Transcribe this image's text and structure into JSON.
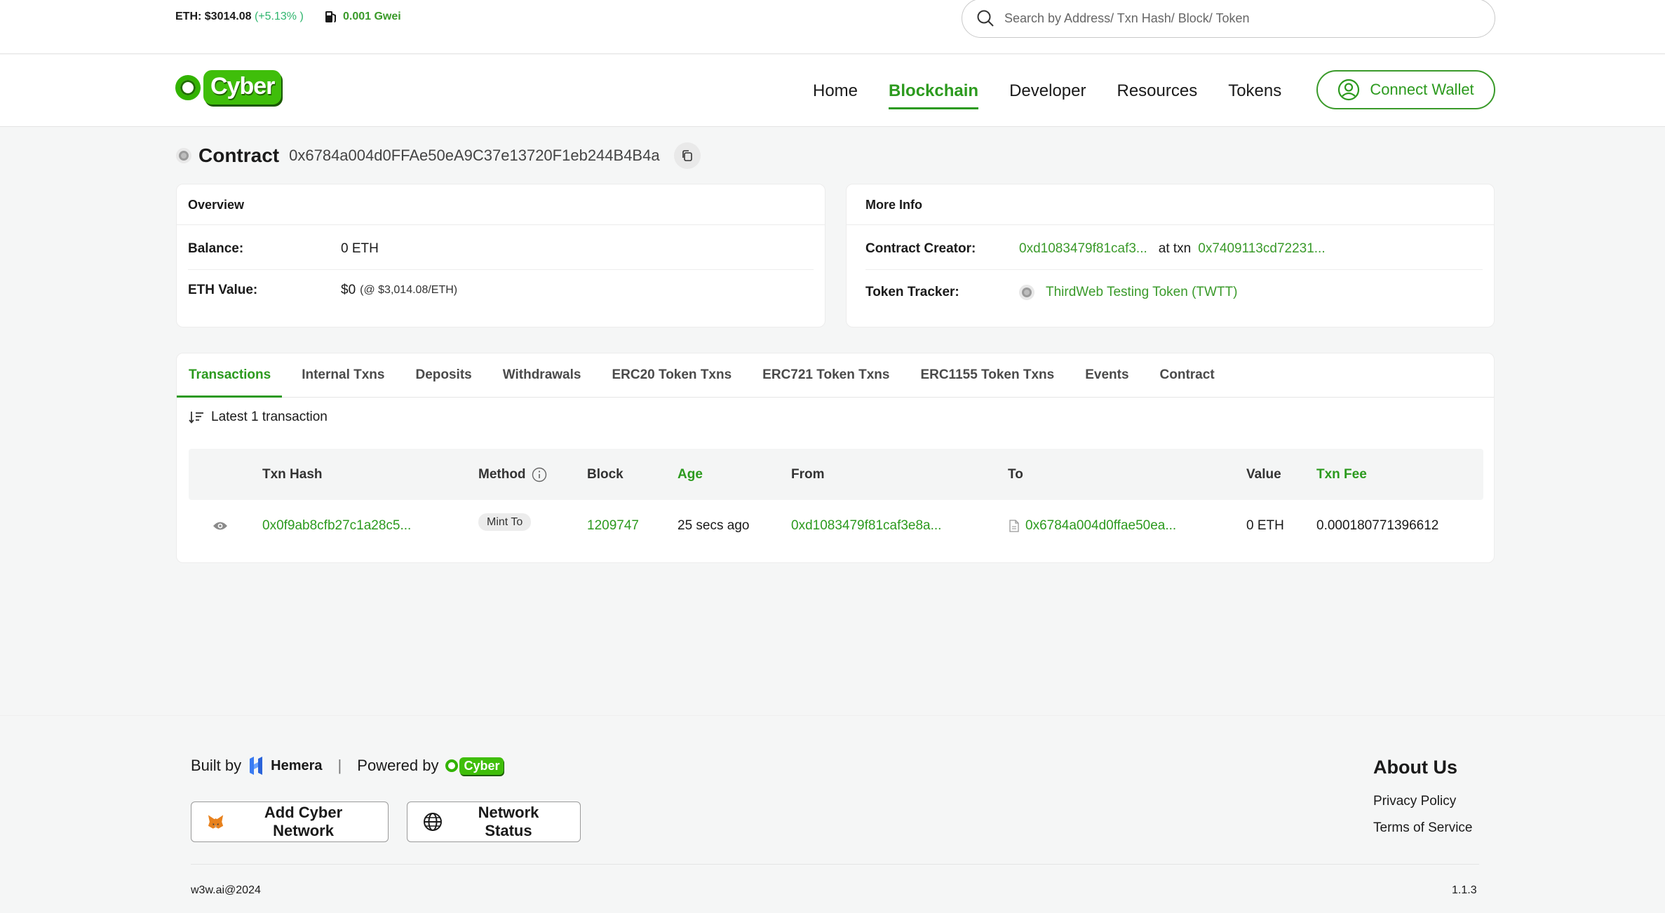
{
  "topbar": {
    "eth_price": "ETH: $3014.08",
    "eth_change": "(+5.13% )",
    "gas": "0.001 Gwei",
    "search_placeholder": "Search by Address/ Txn Hash/ Block/ Token"
  },
  "nav": {
    "logo_text": "Cyber",
    "links": [
      "Home",
      "Blockchain",
      "Developer",
      "Resources",
      "Tokens"
    ],
    "active": "Blockchain",
    "connect_label": "Connect Wallet"
  },
  "contract": {
    "label": "Contract",
    "address": "0x6784a004d0FFAe50eA9C37e13720F1eb244B4B4a"
  },
  "overview": {
    "title": "Overview",
    "balance_label": "Balance:",
    "balance_value": "0 ETH",
    "eth_value_label": "ETH Value:",
    "eth_value": "$0",
    "eth_value_note": "(@ $3,014.08/ETH)"
  },
  "more_info": {
    "title": "More Info",
    "creator_label": "Contract Creator:",
    "creator_address": "0xd1083479f81caf3...",
    "at_txn": "at txn",
    "creator_txn": "0x7409113cd72231...",
    "tracker_label": "Token Tracker:",
    "tracker_value": "ThirdWeb Testing Token (TWTT)"
  },
  "tabs": [
    "Transactions",
    "Internal Txns",
    "Deposits",
    "Withdrawals",
    "ERC20 Token Txns",
    "ERC721 Token Txns",
    "ERC1155 Token Txns",
    "Events",
    "Contract"
  ],
  "latest_label": "Latest 1 transaction",
  "table": {
    "headers": {
      "hash": "Txn Hash",
      "method": "Method",
      "block": "Block",
      "age": "Age",
      "from": "From",
      "to": "To",
      "value": "Value",
      "fee": "Txn Fee"
    },
    "rows": [
      {
        "hash": "0x0f9ab8cfb27c1a28c5...",
        "method": "Mint To",
        "block": "1209747",
        "age": "25 secs ago",
        "from": "0xd1083479f81caf3e8a...",
        "to": "0x6784a004d0ffae50ea...",
        "value": "0 ETH",
        "fee": "0.000180771396612"
      }
    ]
  },
  "footer": {
    "built_by": "Built by",
    "hemera": "Hemera",
    "powered_by": "Powered by",
    "powered_logo": "Cyber",
    "add_network": "Add Cyber Network",
    "network_status": "Network Status",
    "about_title": "About Us",
    "privacy": "Privacy Policy",
    "terms": "Terms of Service",
    "copyright": "w3w.ai@2024",
    "version": "1.1.3"
  },
  "colors": {
    "accent": "#2c9a1e",
    "positive": "#2fb56d",
    "page_bg": "#f5f6f6"
  }
}
